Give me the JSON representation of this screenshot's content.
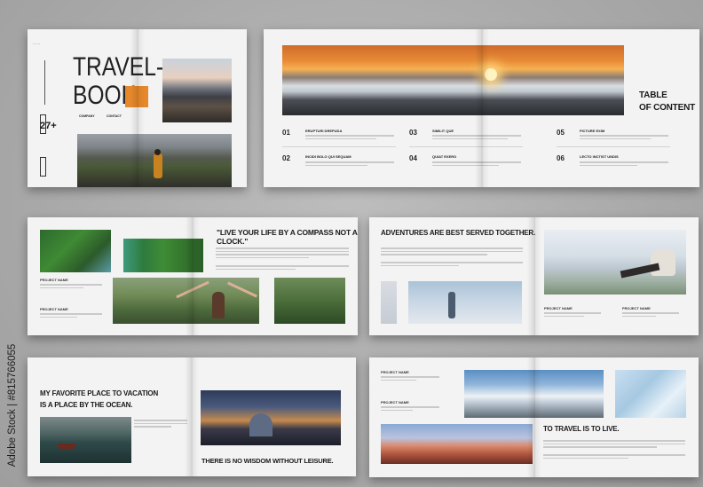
{
  "cover": {
    "title_line1": "TRAVEL-",
    "title_line2": "BOOK",
    "stat_value": "27+",
    "contact_label": "CONTACT",
    "company_label": "COMPANY"
  },
  "toc": {
    "heading_line1": "TABLE",
    "heading_line2": "OF CONTENT",
    "items": [
      {
        "num": "01",
        "title": "ERUPTURI DREPUDA"
      },
      {
        "num": "02",
        "title": "INCIDI BOLO QUI SEQUAM"
      },
      {
        "num": "03",
        "title": "SIMILIT QUE"
      },
      {
        "num": "04",
        "title": "QUIAT EXERO"
      },
      {
        "num": "05",
        "title": "FICTURE EXIM"
      },
      {
        "num": "06",
        "title": "LECTO INCTIST UNDIS"
      }
    ]
  },
  "spread_compass": {
    "quote": "\"LIVE YOUR LIFE BY A COMPASS NOT A CLOCK.\"",
    "label1": "PROJECT NAME",
    "label2": "PROJECT NAME"
  },
  "spread_adventures": {
    "heading": "ADVENTURES ARE BEST SERVED TOGETHER.",
    "label1": "PROJECT NAME",
    "label2": "PROJECT NAME"
  },
  "spread_ocean": {
    "heading_line1": "MY FAVORITE PLACE TO VACATION",
    "heading_line2": "IS A PLACE BY THE OCEAN.",
    "caption": "THERE IS NO WISDOM WITHOUT LEISURE."
  },
  "spread_live": {
    "heading": "TO TRAVEL IS TO LIVE.",
    "label1": "PROJECT NAME",
    "label2": "PROJECT NAME"
  },
  "watermark": {
    "text": "Adobe Stock | #815766055"
  },
  "colors": {
    "accent": "#e6882b",
    "paper": "#f3f3f3",
    "background": "#a9a9a9"
  }
}
